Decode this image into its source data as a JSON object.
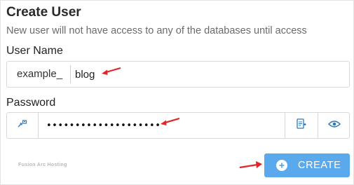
{
  "form": {
    "title": "Create User",
    "subtitle": "New user will not have access to any of the databases until access",
    "username_label": "User Name",
    "username_prefix": "example_",
    "username_value": "blog",
    "password_label": "Password",
    "password_value": "••••••••••••••••••••"
  },
  "icons": {
    "generate": "generate-password-icon",
    "copy": "copy-icon",
    "show": "eye-icon",
    "create": "plus-circle-icon",
    "annotation": "red-arrow-icon"
  },
  "watermark": "Fusion Arc Hosting",
  "create_button": {
    "label": "CREATE"
  },
  "colors": {
    "accent": "#5aa9ec",
    "icon": "#2f79b7",
    "arrow": "#e0262b"
  }
}
